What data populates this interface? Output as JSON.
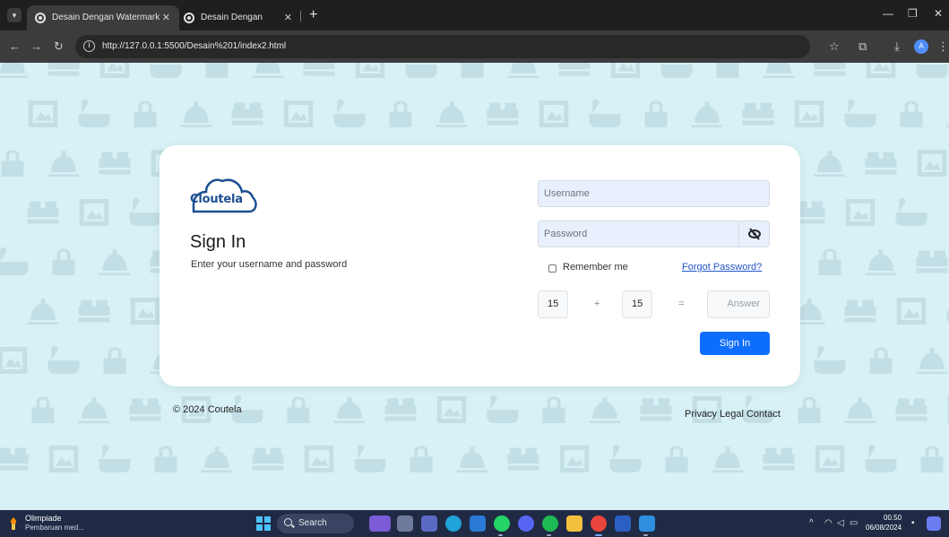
{
  "browser": {
    "tabs": [
      {
        "title": "Desain Dengan Watermark",
        "active": true
      },
      {
        "title": "Desain Dengan Watermark",
        "active": false
      }
    ],
    "new_tab": "+",
    "url": "http://127.0.0.1:5500/Desain%201/index2.html",
    "profile_initial": "A"
  },
  "login": {
    "brand": "Cloutela",
    "title": "Sign In",
    "subtitle": "Enter your username and password",
    "username_placeholder": "Username",
    "password_placeholder": "Password",
    "remember_label": "Remember me",
    "forgot_label": "Forgot Password?",
    "captcha": {
      "a": "15",
      "op": "+",
      "b": "15",
      "eq": "=",
      "answer_placeholder": "Answer"
    },
    "submit_label": "Sign In"
  },
  "footer": {
    "copyright": "© 2024 Coutela",
    "links": [
      "Privacy",
      "Legal",
      "Contact"
    ]
  },
  "taskbar": {
    "weather_title": "Olimpiade",
    "weather_sub": "Pembaruan med...",
    "search_label": "Search",
    "time": "00.50",
    "date": "06/08/2024"
  },
  "colors": {
    "page_bg": "#d7f1f6",
    "watermark": "#c3dfe6",
    "brand": "#1c4f91",
    "primary_button": "#0d6efd",
    "link": "#2456c9"
  }
}
